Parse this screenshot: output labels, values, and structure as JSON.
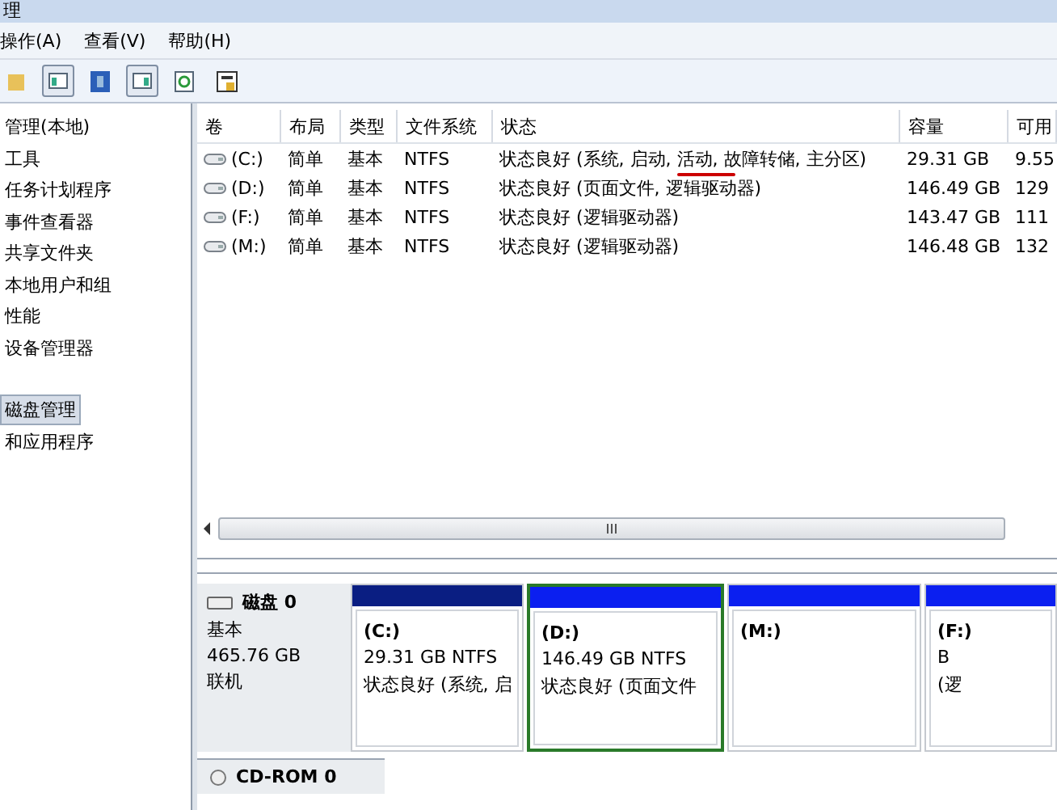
{
  "window": {
    "title": "理"
  },
  "menu": [
    "操作(A)",
    "查看(V)",
    "帮助(H)"
  ],
  "tree": [
    {
      "label": "管理(本地)",
      "selected": false
    },
    {
      "label": "工具",
      "selected": false
    },
    {
      "label": "任务计划程序",
      "selected": false
    },
    {
      "label": "事件查看器",
      "selected": false
    },
    {
      "label": "共享文件夹",
      "selected": false
    },
    {
      "label": "本地用户和组",
      "selected": false
    },
    {
      "label": "性能",
      "selected": false
    },
    {
      "label": "设备管理器",
      "selected": false
    },
    {
      "label": "磁盘管理",
      "selected": true
    },
    {
      "label": "和应用程序",
      "selected": false
    }
  ],
  "table": {
    "columns": [
      "卷",
      "布局",
      "类型",
      "文件系统",
      "状态",
      "容量",
      "可用"
    ],
    "rows": [
      {
        "cells": [
          "(C:)",
          "简单",
          "基本",
          "NTFS",
          "状态良好 (系统, 启动, 活动, 故障转储, 主分区)",
          "29.31 GB",
          "9.55"
        ],
        "marked": true
      },
      {
        "cells": [
          "(D:)",
          "简单",
          "基本",
          "NTFS",
          "状态良好 (页面文件, 逻辑驱动器)",
          "146.49 GB",
          "129"
        ],
        "marked": false
      },
      {
        "cells": [
          "(F:)",
          "简单",
          "基本",
          "NTFS",
          "状态良好 (逻辑驱动器)",
          "143.47 GB",
          "111"
        ],
        "marked": false
      },
      {
        "cells": [
          "(M:)",
          "简单",
          "基本",
          "NTFS",
          "状态良好 (逻辑驱动器)",
          "146.48 GB",
          "132"
        ],
        "marked": false
      }
    ]
  },
  "disks": [
    {
      "name": "磁盘 0",
      "type": "基本",
      "size": "465.76 GB",
      "status": "联机",
      "partitions": [
        {
          "label": "(C:)",
          "size": "29.31 GB NTFS",
          "status": "状态良好 (系统, 启",
          "kind": "primary",
          "selected": false
        },
        {
          "label": "(D:)",
          "size": "146.49 GB NTFS",
          "status": "状态良好 (页面文件",
          "kind": "logical",
          "selected": true
        },
        {
          "label": "(M:)",
          "kind": "logical",
          "selected": false
        },
        {
          "label": "(F:)",
          "size": "B",
          "status": "(逻",
          "kind": "logical",
          "selected": false
        }
      ]
    }
  ],
  "cdrom": {
    "name": "CD-ROM 0"
  }
}
